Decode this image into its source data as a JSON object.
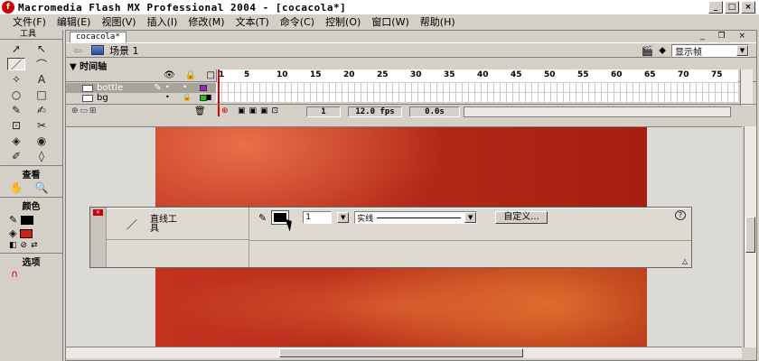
{
  "window": {
    "title": "Macromedia Flash MX Professional 2004 - [cocacola*]",
    "app_icon": "f",
    "controls": [
      "_",
      "□",
      "×"
    ]
  },
  "menu": [
    "文件(F)",
    "编辑(E)",
    "视图(V)",
    "插入(I)",
    "修改(M)",
    "文本(T)",
    "命令(C)",
    "控制(O)",
    "窗口(W)",
    "帮助(H)"
  ],
  "toolbox": {
    "title": "工具",
    "tools": [
      "➚",
      "↖",
      "／",
      "⌒",
      "✧",
      "A",
      "○",
      "□",
      "✎",
      "✍",
      "⊡",
      "✂",
      "◈",
      "◉",
      "✐",
      "◊"
    ],
    "view_label": "查看",
    "view_tools": [
      "✋",
      "🔍"
    ],
    "colors_label": "颜色",
    "options_label": "选项",
    "stroke_color": "#000000",
    "fill_color": "#d42010"
  },
  "document": {
    "tab": "cocacola*",
    "doc_controls": "_ ❐ ×",
    "scene_label": "场景 1",
    "zoom": "显示帧"
  },
  "timeline": {
    "title": "▼ 时间轴",
    "header_icons": "👁 🔒 □",
    "ruler": [
      "1",
      "5",
      "10",
      "15",
      "20",
      "25",
      "30",
      "35",
      "40",
      "45",
      "50",
      "55",
      "60",
      "65",
      "70",
      "75"
    ],
    "layers": [
      {
        "name": "bottle",
        "marks": "• • ■",
        "color": "#a020d0",
        "selected": true
      },
      {
        "name": "bg",
        "marks": "• 🔒 ■",
        "color": "#20c020",
        "selected": false
      }
    ],
    "current_frame": "1",
    "fps": "12.0 fps",
    "time": "0.0s"
  },
  "properties": {
    "tool_name": "直线工具",
    "stroke_width": "1",
    "stroke_style": "实线",
    "custom_button": "自定义...",
    "help": "?"
  }
}
